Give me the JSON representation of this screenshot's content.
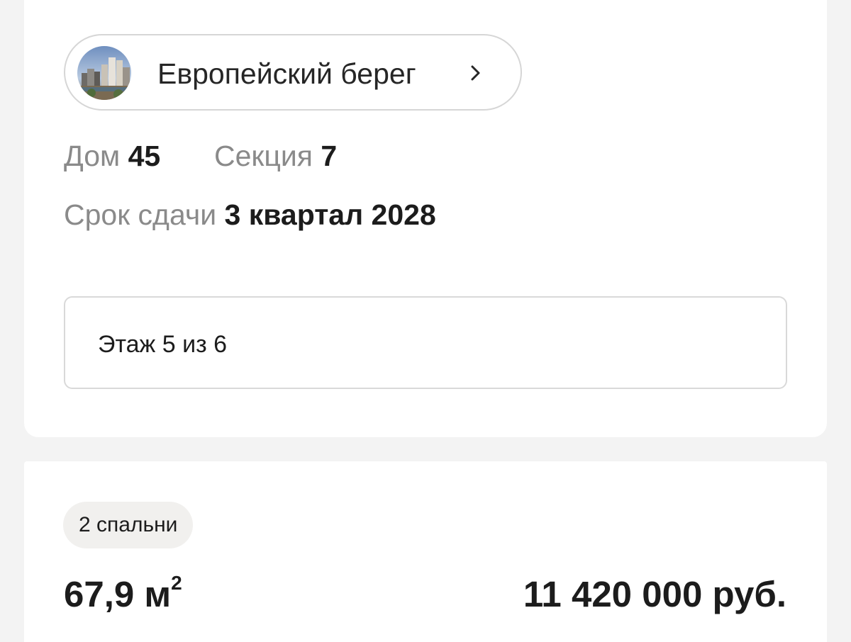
{
  "project": {
    "name": "Европейский берег",
    "avatar_icon": "building-photo-icon",
    "chevron_icon": "chevron-right-icon"
  },
  "details": {
    "house_label": "Дом",
    "house_value": "45",
    "section_label": "Секция",
    "section_value": "7",
    "deadline_label": "Срок сдачи",
    "deadline_value": "3 квартал 2028"
  },
  "floor": {
    "text": "Этаж 5 из 6"
  },
  "listing": {
    "bedrooms_chip": "2 спальни",
    "area_value": "67,9 м",
    "area_unit_sup": "2",
    "price": "11 420 000 руб."
  },
  "colors": {
    "page_background": "#f3f3f3",
    "card_background": "#ffffff",
    "label_gray": "#8a8a8a",
    "text_dark": "#1c1c1c",
    "chip_background": "#f1f0ee",
    "border_gray": "#d6d6d6"
  }
}
